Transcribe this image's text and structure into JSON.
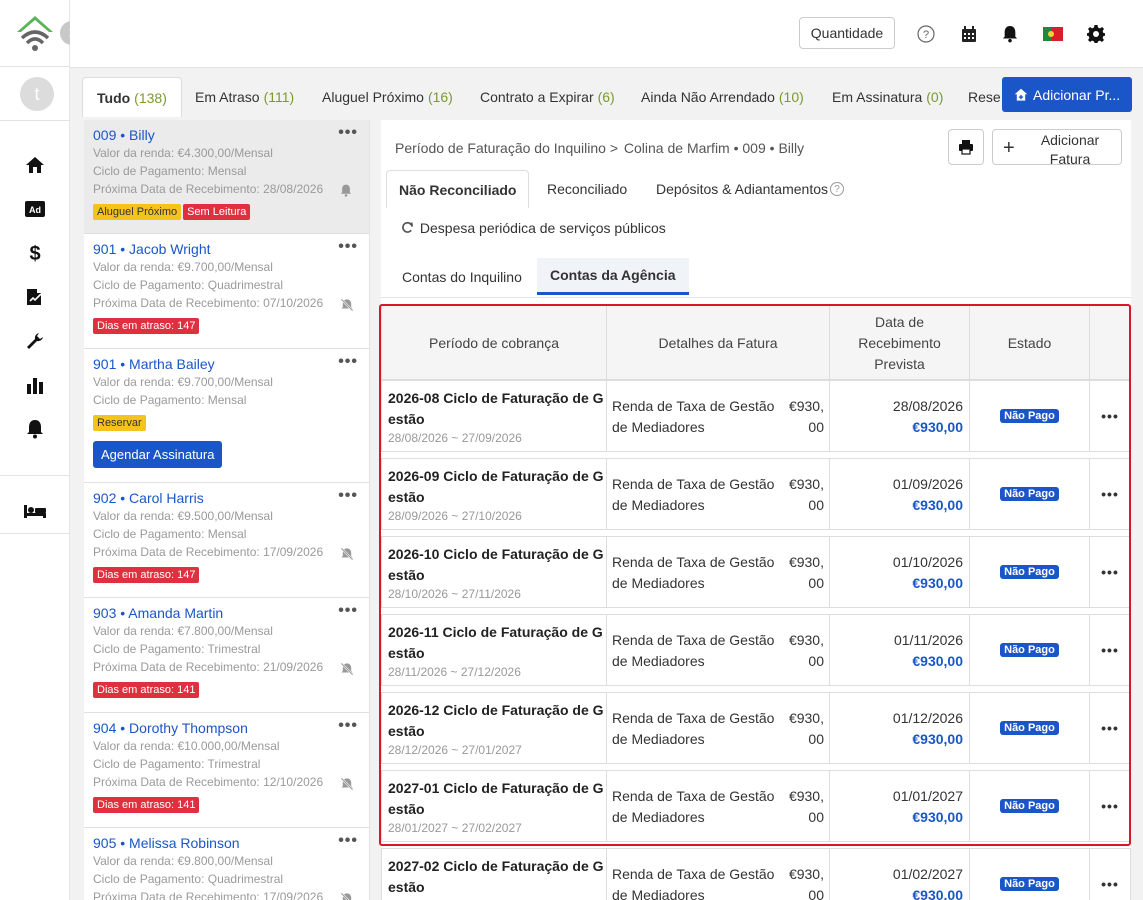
{
  "header": {
    "quantity_label": "Quantidade",
    "add_property_label": "Adicionar Pr..."
  },
  "sidebar": {
    "avatar_letter": "t",
    "nav_icons": [
      "home-icon",
      "ad-icon",
      "dollar-icon",
      "signature-icon",
      "wrench-icon",
      "chart-icon",
      "bell-icon",
      "bed-icon"
    ]
  },
  "tabs": [
    {
      "label": "Tudo",
      "count": "(138)"
    },
    {
      "label": "Em Atraso",
      "count": "(111)"
    },
    {
      "label": "Aluguel Próximo",
      "count": "(16)"
    },
    {
      "label": "Contrato a Expirar",
      "count": "(6)"
    },
    {
      "label": "Ainda Não Arrendado",
      "count": "(10)"
    },
    {
      "label": "Em Assinatura",
      "count": "(0)"
    },
    {
      "label": "Rese",
      "count": ""
    }
  ],
  "tenants": [
    {
      "unit": "009",
      "name": "Billy",
      "rent": "Valor da renda: €4.300,00/Mensal",
      "cycle": "Ciclo de Pagamento: Mensal",
      "next": "Próxima Data de Recebimento:  28/08/2026",
      "badges": [
        "Aluguel Próximo",
        "Sem Leitura"
      ]
    },
    {
      "unit": "901",
      "name": "Jacob Wright",
      "rent": "Valor da renda: €9.700,00/Mensal",
      "cycle": "Ciclo de Pagamento: Quadrimestral",
      "next": "Próxima Data de Recebimento:  07/10/2026",
      "badges": [
        "Dias em atraso: 147"
      ]
    },
    {
      "unit": "901",
      "name": "Martha Bailey",
      "rent": "Valor da renda: €9.700,00/Mensal",
      "cycle": "Ciclo de Pagamento: Mensal",
      "badges": [
        "Reservar"
      ],
      "button": "Agendar Assinatura"
    },
    {
      "unit": "902",
      "name": "Carol Harris",
      "rent": "Valor da renda: €9.500,00/Mensal",
      "cycle": "Ciclo de Pagamento: Mensal",
      "next": "Próxima Data de Recebimento:  17/09/2026",
      "badges": [
        "Dias em atraso: 147"
      ]
    },
    {
      "unit": "903",
      "name": "Amanda Martin",
      "rent": "Valor da renda: €7.800,00/Mensal",
      "cycle": "Ciclo de Pagamento: Trimestral",
      "next": "Próxima Data de Recebimento:  21/09/2026",
      "badges": [
        "Dias em atraso: 141"
      ]
    },
    {
      "unit": "904",
      "name": "Dorothy Thompson",
      "rent": "Valor da renda: €10.000,00/Mensal",
      "cycle": "Ciclo de Pagamento: Trimestral",
      "next": "Próxima Data de Recebimento:  12/10/2026",
      "badges": [
        "Dias em atraso: 141"
      ]
    },
    {
      "unit": "905",
      "name": "Melissa Robinson",
      "rent": "Valor da renda: €9.800,00/Mensal",
      "cycle": "Ciclo de Pagamento: Quadrimestral",
      "next": "Próxima Data de Recebimento:  17/09/2026",
      "badges": []
    }
  ],
  "main": {
    "crumb_root": "Período de Faturação do Inquilino",
    "crumb_sep": ">",
    "crumb_leaf": "Colina de Marfim • 009 • Billy",
    "add_invoice_label": "Adicionar Fatura",
    "subtabs": [
      "Não Reconciliado",
      "Reconciliado",
      "Depósitos & Adiantamentos"
    ],
    "periodic_label": "Despesa periódica de serviços públicos",
    "account_tabs": [
      "Contas do Inquilino",
      "Contas da Agência"
    ],
    "columns": [
      "Período de cobrança",
      "Detalhes da Fatura",
      "Data de Recebimento Prevista",
      "Estado",
      ""
    ],
    "rows": [
      {
        "title": "2026-08 Ciclo de Faturação de Gestão",
        "range": "28/08/2026 ~ 27/09/2026",
        "detail": "Renda de Taxa de Gestão de Mediadores",
        "amount": "€930,00",
        "due_date": "28/08/2026",
        "due_amount": "€930,00",
        "status": "Não Pago"
      },
      {
        "title": "2026-09 Ciclo de Faturação de Gestão",
        "range": "28/09/2026 ~ 27/10/2026",
        "detail": "Renda de Taxa de Gestão de Mediadores",
        "amount": "€930,00",
        "due_date": "01/09/2026",
        "due_amount": "€930,00",
        "status": "Não Pago"
      },
      {
        "title": "2026-10 Ciclo de Faturação de Gestão",
        "range": "28/10/2026 ~ 27/11/2026",
        "detail": "Renda de Taxa de Gestão de Mediadores",
        "amount": "€930,00",
        "due_date": "01/10/2026",
        "due_amount": "€930,00",
        "status": "Não Pago"
      },
      {
        "title": "2026-11 Ciclo de Faturação de Gestão",
        "range": "28/11/2026 ~ 27/12/2026",
        "detail": "Renda de Taxa de Gestão de Mediadores",
        "amount": "€930,00",
        "due_date": "01/11/2026",
        "due_amount": "€930,00",
        "status": "Não Pago"
      },
      {
        "title": "2026-12 Ciclo de Faturação de Gestão",
        "range": "28/12/2026 ~ 27/01/2027",
        "detail": "Renda de Taxa de Gestão de Mediadores",
        "amount": "€930,00",
        "due_date": "01/12/2026",
        "due_amount": "€930,00",
        "status": "Não Pago"
      },
      {
        "title": "2027-01 Ciclo de Faturação de Gestão",
        "range": "28/01/2027 ~ 27/02/2027",
        "detail": "Renda de Taxa de Gestão de Mediadores",
        "amount": "€930,00",
        "due_date": "01/01/2027",
        "due_amount": "€930,00",
        "status": "Não Pago"
      },
      {
        "title": "2027-02 Ciclo de Faturação de Gestão",
        "range": "",
        "detail": "Renda de Taxa de Gestão de Mediadores",
        "amount": "€930,00",
        "due_date": "01/02/2027",
        "due_amount": "€930,00",
        "status": "Não Pago"
      }
    ]
  },
  "colors": {
    "accent": "#1a56c8",
    "danger": "#e03040",
    "warning": "#f6c21c",
    "highlight": "#d6182a"
  }
}
